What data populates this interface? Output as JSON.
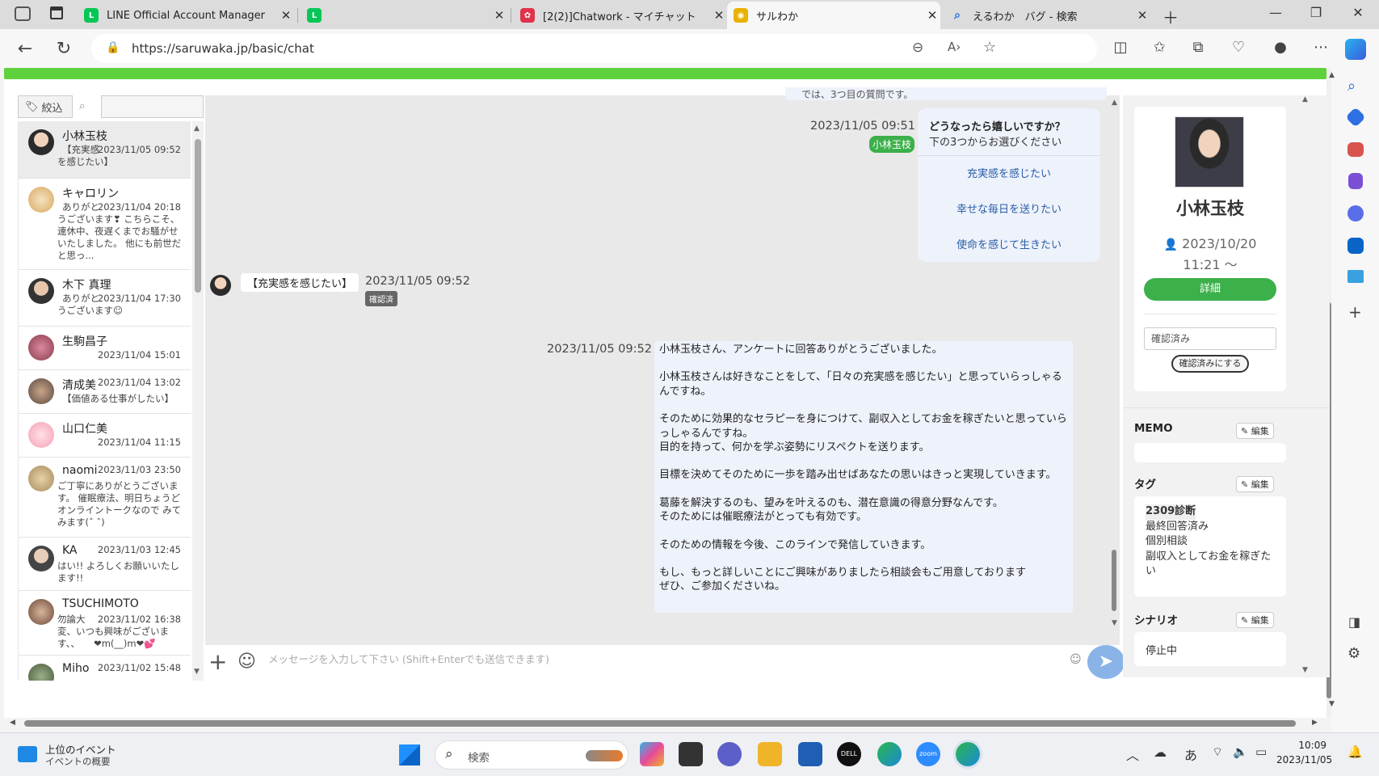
{
  "browser": {
    "tabs": [
      {
        "title": "LINE Official Account Manager",
        "color": "#06c755",
        "glyph": "L"
      },
      {
        "title": "",
        "color": "#06c755",
        "glyph": "L"
      },
      {
        "title": "[2(2)]Chatwork - マイチャット",
        "color": "#e0314b",
        "glyph": "✿"
      },
      {
        "title": "サルわか",
        "color": "#e8b200",
        "glyph": "◉"
      },
      {
        "title": "えるわか　バグ - 検索",
        "color": "#1a6ed8",
        "glyph": "⌕"
      }
    ],
    "url": "https://saruwaka.jp/basic/chat"
  },
  "chat_list": {
    "filter_label": "絞込",
    "friends": [
      {
        "name": "小林玉枝",
        "time": "2023/11/05 09:52",
        "preview_first": "【充実感",
        "preview_rest": "を感じたい】"
      },
      {
        "name": "キャロリン",
        "time": "2023/11/04 20:18",
        "preview_first": "ありがと",
        "preview_rest": "うございます❣ こちらこそ、連休中、夜遅くまでお騒がせいたしました。 他にも前世だと思っ..."
      },
      {
        "name": "木下 真理",
        "time": "2023/11/04 17:30",
        "preview_first": "ありがと",
        "preview_rest": "うございます☺"
      },
      {
        "name": "生駒昌子",
        "time": "2023/11/04 15:01",
        "preview_first": "",
        "preview_rest": ""
      },
      {
        "name": "清成美",
        "time": "2023/11/04 13:02",
        "preview_first": "",
        "preview_rest": "【価値ある仕事がしたい】"
      },
      {
        "name": "山口仁美",
        "time": "2023/11/04 11:15",
        "preview_first": "",
        "preview_rest": ""
      },
      {
        "name": "naomi",
        "time": "2023/11/03 23:50",
        "preview_first": "",
        "preview_rest": "ご丁寧にありがとうございます。 催眠療法、明日ちょうどオンライントークなので みてみます(ˆ ˆ)"
      },
      {
        "name": "KA",
        "time": "2023/11/03 12:45",
        "preview_first": "",
        "preview_rest": "はい!! よろしくお願いいたします!!"
      },
      {
        "name": "TSUCHIMOTO",
        "time": "2023/11/02 16:38",
        "preview_first": "勿論大",
        "preview_rest": "変、いつも興味がございます、、　　❤m(__)m❤💕"
      },
      {
        "name": "Miho",
        "time": "2023/11/02 15:48",
        "preview_first": "",
        "preview_rest": ""
      }
    ]
  },
  "chat": {
    "top_partial": "では、3つ目の質問です。",
    "msg1": {
      "time": "2023/11/05 09:51",
      "sender": "小林玉枝",
      "question": "どうなったら嬉しいですか？",
      "sub": "下の3つからお選びください",
      "options": [
        "充実感を感じたい",
        "幸せな毎日を送りたい",
        "使命を感じて生きたい"
      ]
    },
    "msg2": {
      "text": "【充実感を感じたい】",
      "time": "2023/11/05 09:52",
      "badge": "確認済"
    },
    "msg3": {
      "time": "2023/11/05 09:52",
      "lines": [
        "小林玉枝さん、アンケートに回答ありがとうございました。",
        "",
        "小林玉枝さんは好きなことをして、「日々の充実感を感じたい」と思っていらっしゃるんですね。",
        "",
        "そのために効果的なセラピーを身につけて、副収入としてお金を稼ぎたいと思っていらっしゃるんですね。",
        "目的を持って、何かを学ぶ姿勢にリスペクトを送ります。",
        "",
        "目標を決めてそのために一歩を踏み出せばあなたの思いはきっと実現していきます。",
        "",
        "葛藤を解決するのも、望みを叶えるのも、潜在意識の得意分野なんです。",
        "そのためには催眠療法がとっても有効です。",
        "",
        "そのための情報を今後、このラインで発信していきます。",
        "",
        "もし、もっと詳しいことにご興味がありましたら相談会もご用意しております",
        "ぜひ、ご参加くださいね。"
      ]
    },
    "input_placeholder": "メッセージを入力して下さい (Shift+Enterでも送信できます)"
  },
  "profile": {
    "name": "小林玉枝",
    "since_date": "2023/10/20",
    "since_time": "11:21 〜",
    "detail_button": "詳細",
    "status_value": "確認済み",
    "confirm_button": "確認済みにする",
    "memo_label": "MEMO",
    "edit_label": "編集",
    "tag_label": "タグ",
    "tags": [
      "2309診断",
      "最終回答済み",
      "個別相談",
      "副収入としてお金を稼ぎたい"
    ],
    "scenario_label": "シナリオ",
    "scenario_value": "停止中"
  },
  "taskbar": {
    "widget_title": "上位のイベント",
    "widget_sub": "イベントの概要",
    "search_placeholder": "検索",
    "ime": "あ",
    "time": "10:09",
    "date": "2023/11/05"
  }
}
